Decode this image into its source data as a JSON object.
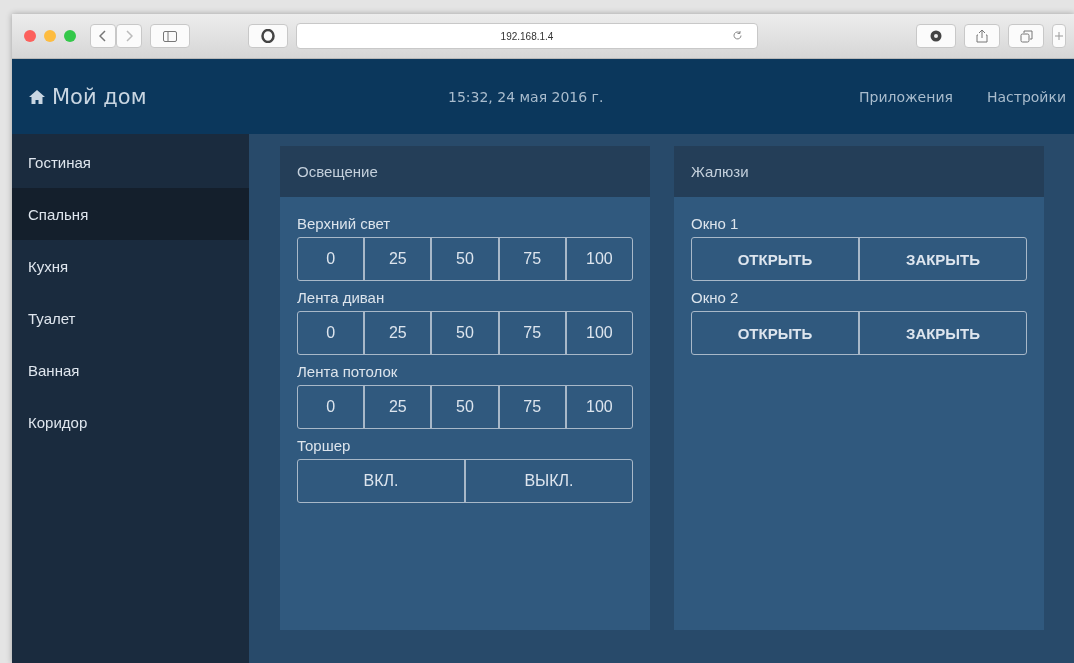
{
  "browser": {
    "url": "192.168.1.4"
  },
  "header": {
    "title": "Мой дом",
    "datetime": "15:32, 24 мая 2016 г.",
    "nav": [
      "Приложения",
      "Настройки"
    ]
  },
  "sidebar": {
    "items": [
      {
        "label": "Гостиная",
        "selected": false
      },
      {
        "label": "Спальня",
        "selected": true
      },
      {
        "label": "Кухня",
        "selected": false
      },
      {
        "label": "Туалет",
        "selected": false
      },
      {
        "label": "Ванная",
        "selected": false
      },
      {
        "label": "Коридор",
        "selected": false
      }
    ]
  },
  "panels": [
    {
      "title": "Освещение",
      "groups": [
        {
          "label": "Верхний свет",
          "buttons": [
            "0",
            "25",
            "50",
            "75",
            "100"
          ]
        },
        {
          "label": "Лента диван",
          "buttons": [
            "0",
            "25",
            "50",
            "75",
            "100"
          ]
        },
        {
          "label": "Лента потолок",
          "buttons": [
            "0",
            "25",
            "50",
            "75",
            "100"
          ]
        },
        {
          "label": "Торшер",
          "buttons": [
            "ВКЛ.",
            "ВЫКЛ."
          ]
        }
      ]
    },
    {
      "title": "Жалюзи",
      "groups": [
        {
          "label": "Окно 1",
          "buttons": [
            "ОТКРЫТЬ",
            "ЗАКРЫТЬ"
          ]
        },
        {
          "label": "Окно 2",
          "buttons": [
            "ОТКРЫТЬ",
            "ЗАКРЫТЬ"
          ]
        }
      ]
    }
  ]
}
